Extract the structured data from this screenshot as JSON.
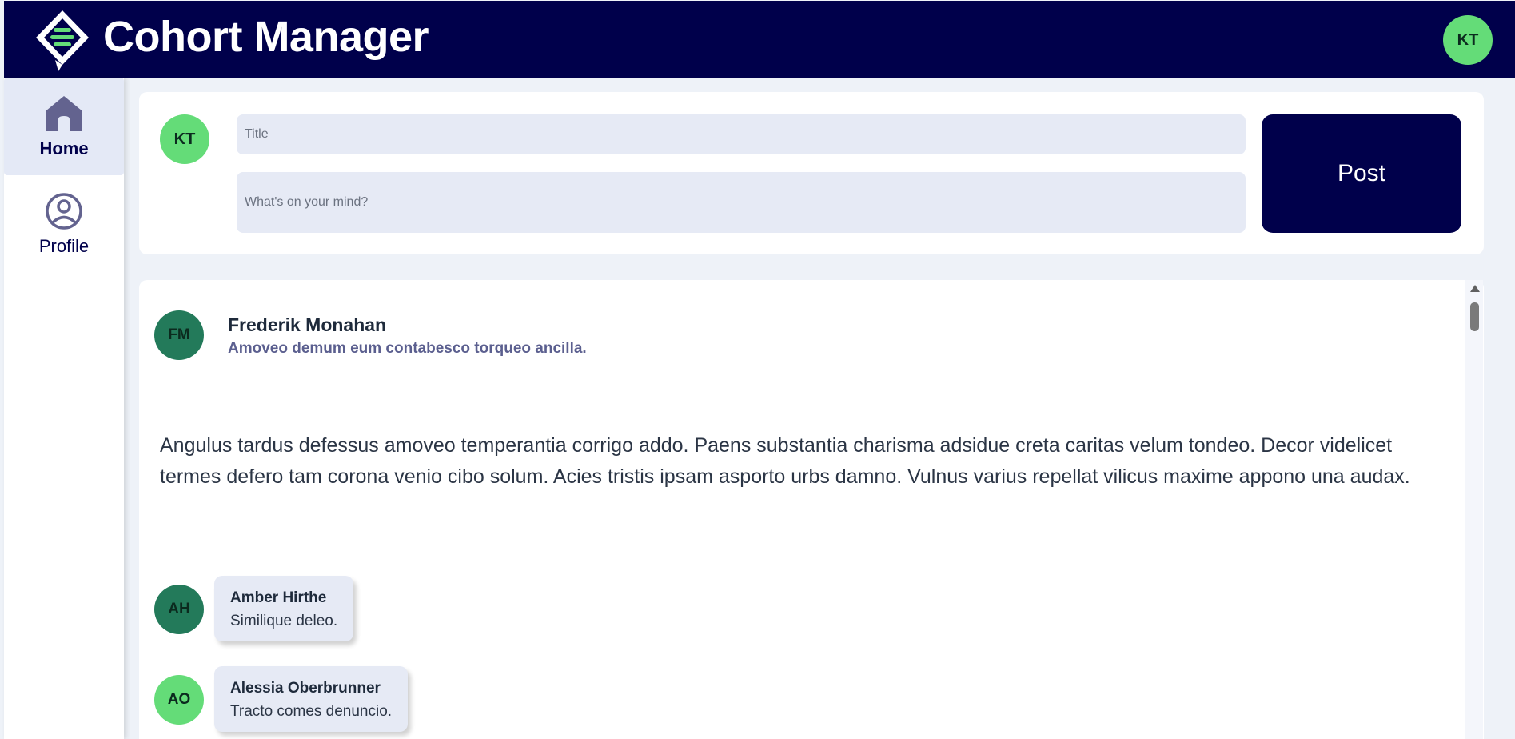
{
  "app": {
    "title": "Cohort Manager",
    "user_initials": "KT",
    "colors": {
      "header_bg": "#00004b",
      "accent_green": "#64dc78",
      "dark_green": "#237a5a",
      "post_button_bg": "#00004b",
      "input_bg": "#e6eaf5"
    }
  },
  "sidebar": {
    "items": [
      {
        "label": "Home",
        "icon": "home-icon",
        "active": true
      },
      {
        "label": "Profile",
        "icon": "user-circle-icon",
        "active": false
      }
    ]
  },
  "composer": {
    "avatar_initials": "KT",
    "title_placeholder": "Title",
    "body_placeholder": "What's on your mind?",
    "post_label": "Post"
  },
  "feed": {
    "posts": [
      {
        "author": "Frederik Monahan",
        "initials": "FM",
        "title": "Amoveo demum eum contabesco torqueo ancilla.",
        "body": "Angulus tardus defessus amoveo temperantia corrigo addo. Paens substantia charisma adsidue creta caritas velum tondeo. Decor videlicet termes defero tam corona venio cibo solum. Acies tristis ipsam asporto urbs damno. Vulnus varius repellat vilicus maxime appono una audax.",
        "comments": [
          {
            "author": "Amber Hirthe",
            "initials": "AH",
            "text": "Similique deleo."
          },
          {
            "author": "Alessia Oberbrunner",
            "initials": "AO",
            "text": "Tracto comes denuncio."
          }
        ]
      }
    ]
  }
}
